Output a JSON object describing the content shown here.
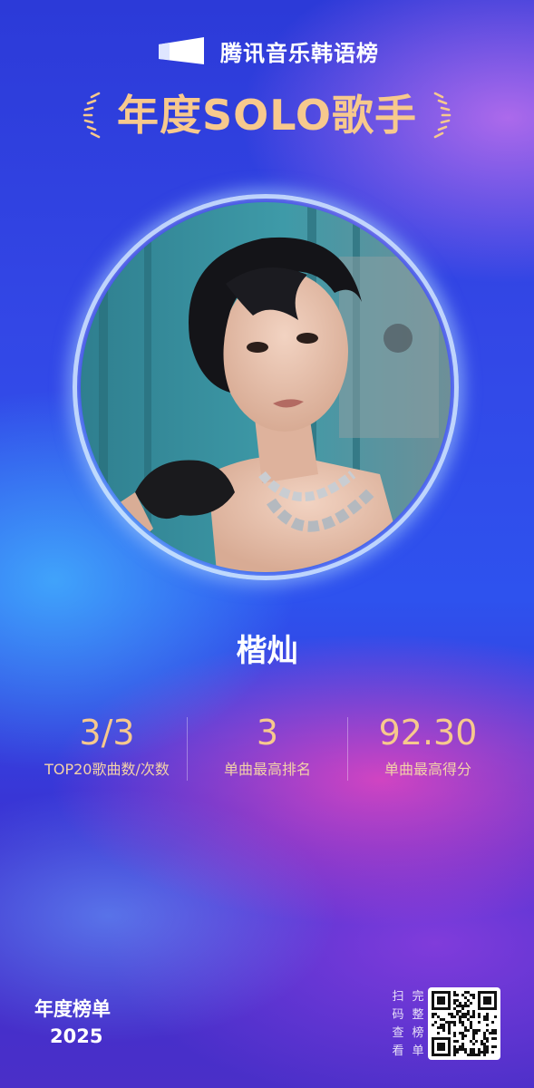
{
  "header": {
    "brand_icon": "tencent-music-logo-icon",
    "brand_name": "腾讯音乐韩语榜",
    "title": "年度SOLO歌手"
  },
  "artist": {
    "name": "楷灿",
    "photo_icon": "artist-portrait-photo"
  },
  "stats": [
    {
      "value": "3/3",
      "label": "TOP20歌曲数/次数"
    },
    {
      "value": "3",
      "label": "单曲最高排名"
    },
    {
      "value": "92.30",
      "label": "单曲最高得分"
    }
  ],
  "footer": {
    "annual_label": "年度榜单",
    "year": "2025",
    "scan_col1": [
      "扫",
      "码",
      "查",
      "看"
    ],
    "scan_col2": [
      "完",
      "整",
      "榜",
      "单"
    ],
    "qr_icon": "qr-code-icon"
  },
  "colors": {
    "accent_gold": "#f7c98d",
    "background_blue": "#3347e6",
    "background_pink": "#eb46be"
  }
}
